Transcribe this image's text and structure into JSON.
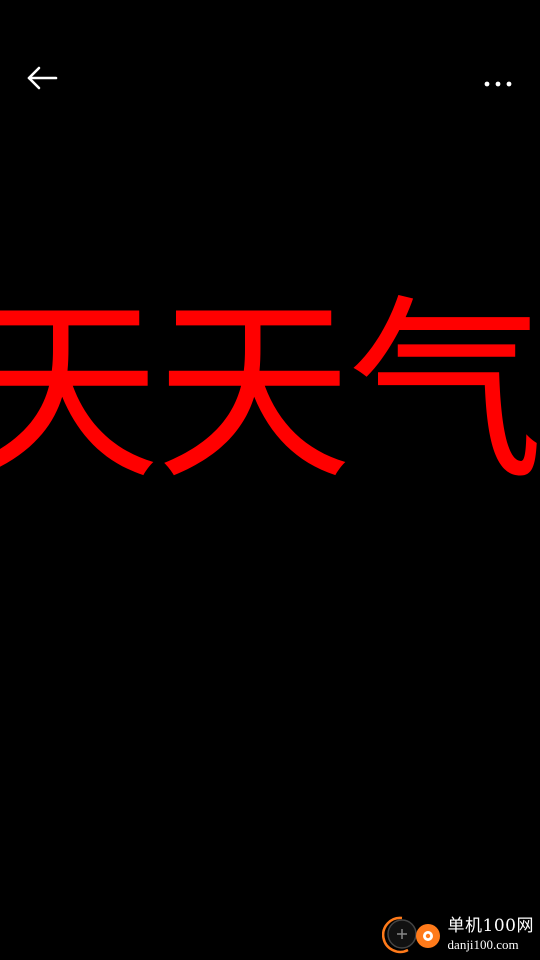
{
  "screen": {
    "background": "#000000"
  },
  "toolbar": {
    "back_icon": "arrow-left-icon",
    "more_icon": "more-horizontal-icon",
    "icon_color": "#ffffff"
  },
  "marquee": {
    "text": "天天气",
    "color": "#ff0000"
  },
  "watermark": {
    "brand": "单机100网",
    "url": "danji100.com",
    "accent": "#ff7a1a"
  }
}
